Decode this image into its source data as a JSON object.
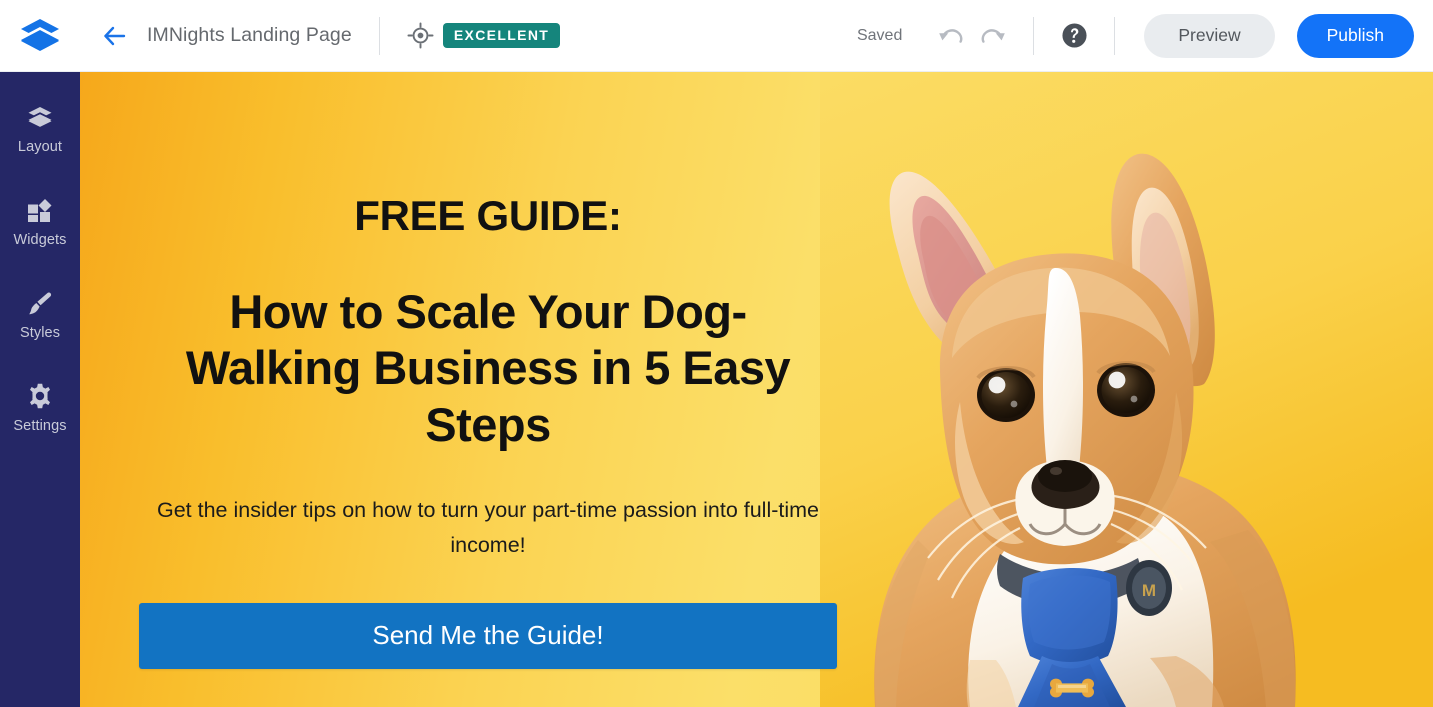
{
  "topbar": {
    "logo_icon": "layers-logo-icon",
    "back_icon": "back-arrow-icon",
    "page_title": "IMNights Landing Page",
    "score": {
      "target_icon": "target-crosshair-icon",
      "badge_label": "EXCELLENT",
      "badge_color": "#15857C"
    },
    "saved_status": "Saved",
    "undo_icon": "undo-icon",
    "redo_icon": "redo-icon",
    "help_icon": "help-circle-icon",
    "preview_label": "Preview",
    "publish_label": "Publish",
    "publish_color": "#1373F8"
  },
  "sidebar": {
    "background_color": "#252766",
    "items": [
      {
        "label": "Layout",
        "icon": "layers-icon"
      },
      {
        "label": "Widgets",
        "icon": "widgets-grid-icon"
      },
      {
        "label": "Styles",
        "icon": "paintbrush-icon"
      },
      {
        "label": "Settings",
        "icon": "gear-icon"
      }
    ]
  },
  "hero": {
    "background_gradient_from": "#F6A81B",
    "background_gradient_to": "#FADC62",
    "eyebrow": "FREE GUIDE:",
    "headline": "How to Scale Your Dog-Walking Business in 5 Easy Steps",
    "subhead": "Get the insider tips on how to turn your part-time passion into full-time income!",
    "cta_label": "Send Me the Guide!",
    "cta_color": "#1273C2",
    "image_alt": "corgi-puppy-wearing-blue-necktie"
  }
}
